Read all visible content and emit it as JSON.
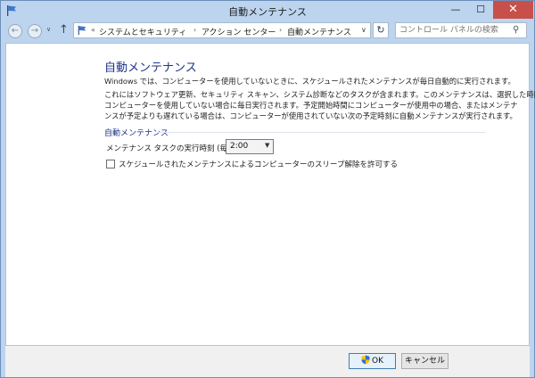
{
  "window": {
    "title": "自動メンテナンス",
    "minimize_glyph": "—",
    "maximize_glyph": "☐",
    "close_glyph": "✕"
  },
  "nav": {
    "back_glyph": "←",
    "forward_glyph": "→",
    "history_glyph": "∨",
    "up_glyph": "↑",
    "overflow": "«",
    "separator": "›",
    "breadcrumbs": [
      "システムとセキュリティ",
      "アクション センター",
      "自動メンテナンス"
    ],
    "address_dropdown_glyph": "∨",
    "refresh_glyph": "↻",
    "search_placeholder": "コントロール パネルの検索",
    "search_icon_glyph": "⚲"
  },
  "main": {
    "heading": "自動メンテナンス",
    "intro": "Windows では、コンピューターを使用していないときに、スケジュールされたメンテナンスが毎日自動的に実行されます。",
    "details": [
      "これにはソフトウェア更新、セキュリティ スキャン、システム診断などのタスクが含まれます。このメンテナンスは、選択した時間に",
      "コンピューターを使用していない場合に毎日実行されます。予定開始時間にコンピューターが使用中の場合、またはメンテナ",
      "ンスが予定よりも遅れている場合は、コンピューターが使用されていない次の予定時刻に自動メンテナンスが実行されます。"
    ],
    "section_label": "自動メンテナンス",
    "time_label": "メンテナンス タスクの実行時刻 (毎日):",
    "time_value": "2:00",
    "time_dropdown_glyph": "▼",
    "wake_checkbox_label": "スケジュールされたメンテナンスによるコンピューターのスリープ解除を許可する",
    "wake_checked": false
  },
  "footer": {
    "ok_label": "OK",
    "cancel_label": "キャンセル"
  },
  "colors": {
    "heading": "#1e3287",
    "titlebar": "#bcd4ee",
    "close_button": "#c7504a"
  },
  "icons": [
    "flag-icon",
    "shield-icon",
    "search-icon",
    "refresh-icon"
  ]
}
